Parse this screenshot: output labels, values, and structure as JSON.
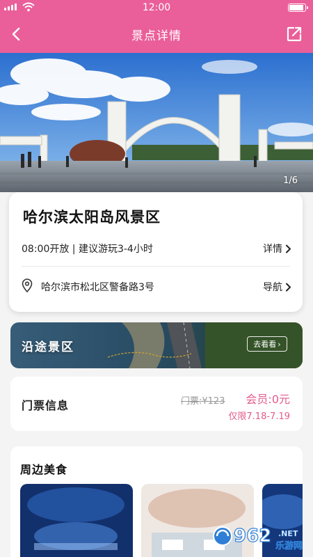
{
  "status_bar": {
    "time": "12:00"
  },
  "nav": {
    "title": "景点详情",
    "back_icon": "chevron-left-icon",
    "share_icon": "share-icon",
    "color": "#ea5f9a"
  },
  "hero": {
    "counter": "1/6"
  },
  "attraction": {
    "name": "哈尔滨太阳岛风景区",
    "hours": "08:00开放 | 建议游玩3-4小时",
    "details_link": "详情",
    "address": "哈尔滨市松北区警备路3号",
    "nav_link": "导航"
  },
  "route": {
    "label": "沿途景区",
    "button": "去看看"
  },
  "ticket": {
    "label": "门票信息",
    "original_price": "门票:¥123",
    "member_price": "会员:0元",
    "limit": "仅限7.18-7.19",
    "accent": "#e25b8c"
  },
  "food": {
    "title": "周边美食"
  },
  "watermark": {
    "text": "962",
    "suffix": ".NET",
    "sub": "乐游网"
  }
}
